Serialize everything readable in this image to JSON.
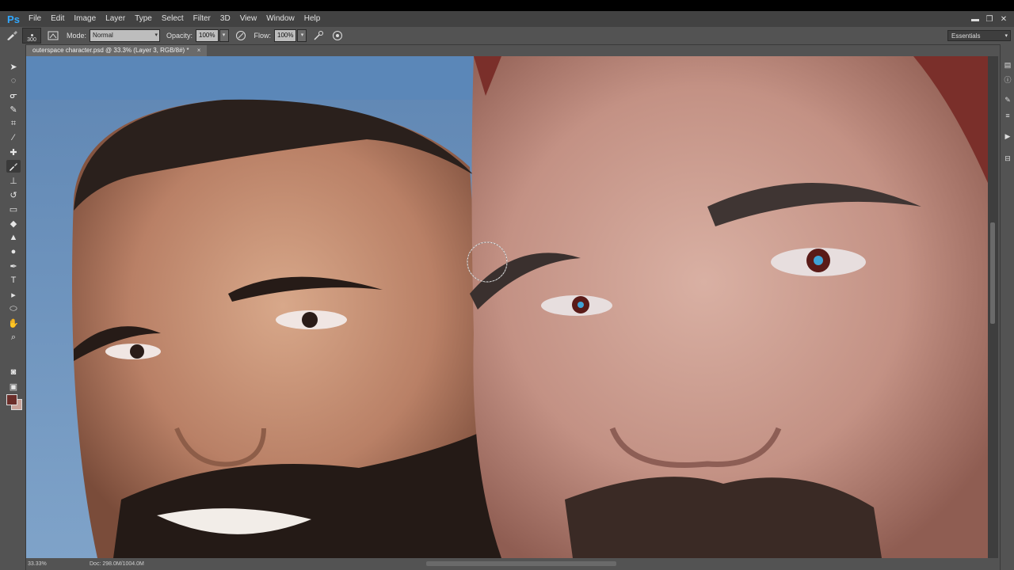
{
  "app": {
    "logo": "Ps"
  },
  "menu": [
    "File",
    "Edit",
    "Image",
    "Layer",
    "Type",
    "Select",
    "Filter",
    "3D",
    "View",
    "Window",
    "Help"
  ],
  "window_controls": {
    "minimize": "▬",
    "restore": "❐",
    "close": "✕"
  },
  "options": {
    "brush_size": "300",
    "mode_label": "Mode:",
    "mode_value": "Normal",
    "opacity_label": "Opacity:",
    "opacity_value": "100%",
    "flow_label": "Flow:",
    "flow_value": "100%",
    "workspace": "Essentials"
  },
  "document": {
    "tab_title": "outerspace character.psd @ 33.3% (Layer 3, RGB/8#) *",
    "close_glyph": "×"
  },
  "status": {
    "zoom": "33.33%",
    "doc": "Doc: 298.0M/1004.0M"
  },
  "colors": {
    "foreground": "#6b2e2a",
    "background": "#c9a39a",
    "ui_dark": "#424242",
    "ui_panel": "#535353",
    "backdrop": "#6f8fb8"
  }
}
